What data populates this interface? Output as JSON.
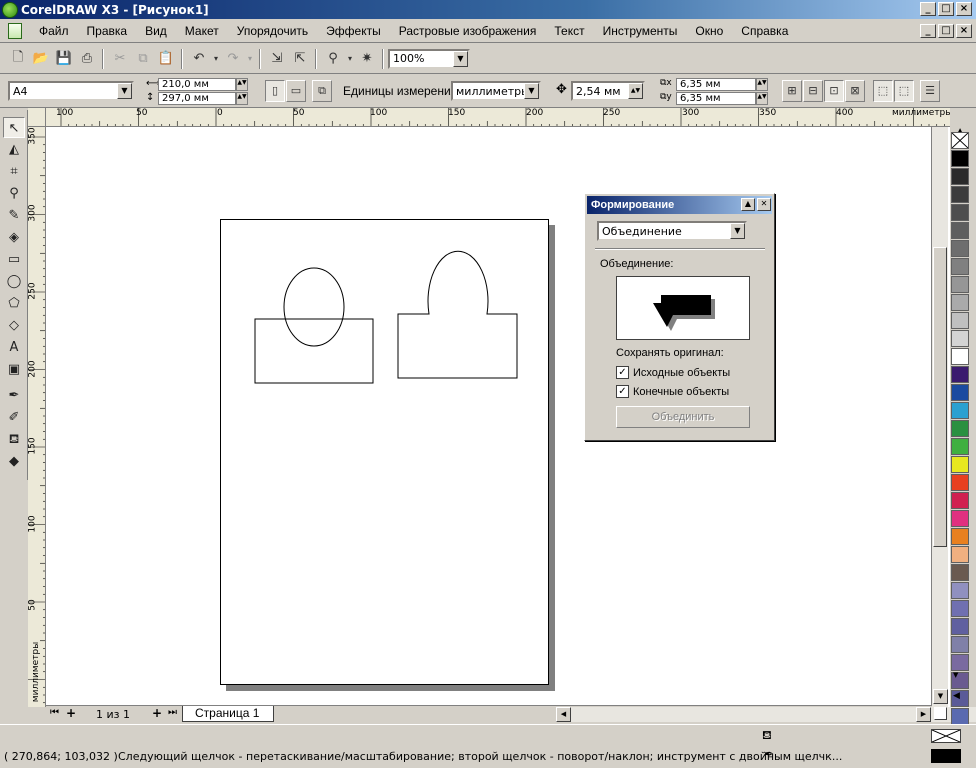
{
  "window": {
    "title": "CorelDRAW X3 - [Рисунок1]",
    "buttons": [
      "_",
      "□",
      "×"
    ]
  },
  "menubar": {
    "items": [
      "Файл",
      "Правка",
      "Вид",
      "Макет",
      "Упорядочить",
      "Эффекты",
      "Растровые изображения",
      "Текст",
      "Инструменты",
      "Окно",
      "Справка"
    ]
  },
  "toolbar1": {
    "zoom_value": "100%"
  },
  "property_bar": {
    "paper_size": "A4",
    "width": "210,0 мм",
    "height": "297,0 мм",
    "units_label": "Единицы измерения:",
    "units_value": "миллиметры",
    "nudge": "2,54 мм",
    "dup_x": "6,35 мм",
    "dup_y": "6,35 мм"
  },
  "ruler": {
    "top_labels": [
      "100",
      "50",
      "0",
      "50",
      "100",
      "150",
      "200",
      "250",
      "300",
      "350",
      "400"
    ],
    "top_unit": "миллиметры",
    "left_labels": [
      "350",
      "300",
      "250",
      "200",
      "150",
      "100",
      "50"
    ],
    "left_unit": "миллиметры"
  },
  "page_nav": {
    "counter": "1 из 1",
    "tab_label": "Страница 1"
  },
  "docker": {
    "title": "Формирование",
    "operation": "Объединение",
    "preview_label": "Объединение:",
    "keep_original_label": "Сохранять оригинал:",
    "source_objects_label": "Исходные объекты",
    "source_objects_checked": true,
    "target_objects_label": "Конечные объекты",
    "target_objects_checked": true,
    "apply_button": "Объединить"
  },
  "status": {
    "coords": "( 270,864; 103,032 )",
    "message": "Следующий щелчок - перетаскивание/масштабирование; второй щелчок - поворот/наклон; инструмент с двойным щелчк..."
  },
  "palette": {
    "colors": [
      "#000000",
      "#2a2a2a",
      "#3c3c3c",
      "#4e4e4e",
      "#5e5e5e",
      "#6e6e6e",
      "#808080",
      "#969696",
      "#aaaaaa",
      "#c0c0c0",
      "#d4d4d4",
      "#ffffff",
      "#3a1a6e",
      "#1a4aa0",
      "#2aa0d0",
      "#2a9040",
      "#40b040",
      "#e8e820",
      "#e84020",
      "#d02050",
      "#e03080",
      "#e88020",
      "#f0b080",
      "#6a5a50",
      "#9090c0",
      "#7070b0",
      "#6060a0",
      "#8080a8",
      "#7a6aa0",
      "#6a5a90",
      "#5a5a98",
      "#5a6ab0",
      "#6a8ab0",
      "#3a6a98",
      "#1a7ad0"
    ]
  }
}
